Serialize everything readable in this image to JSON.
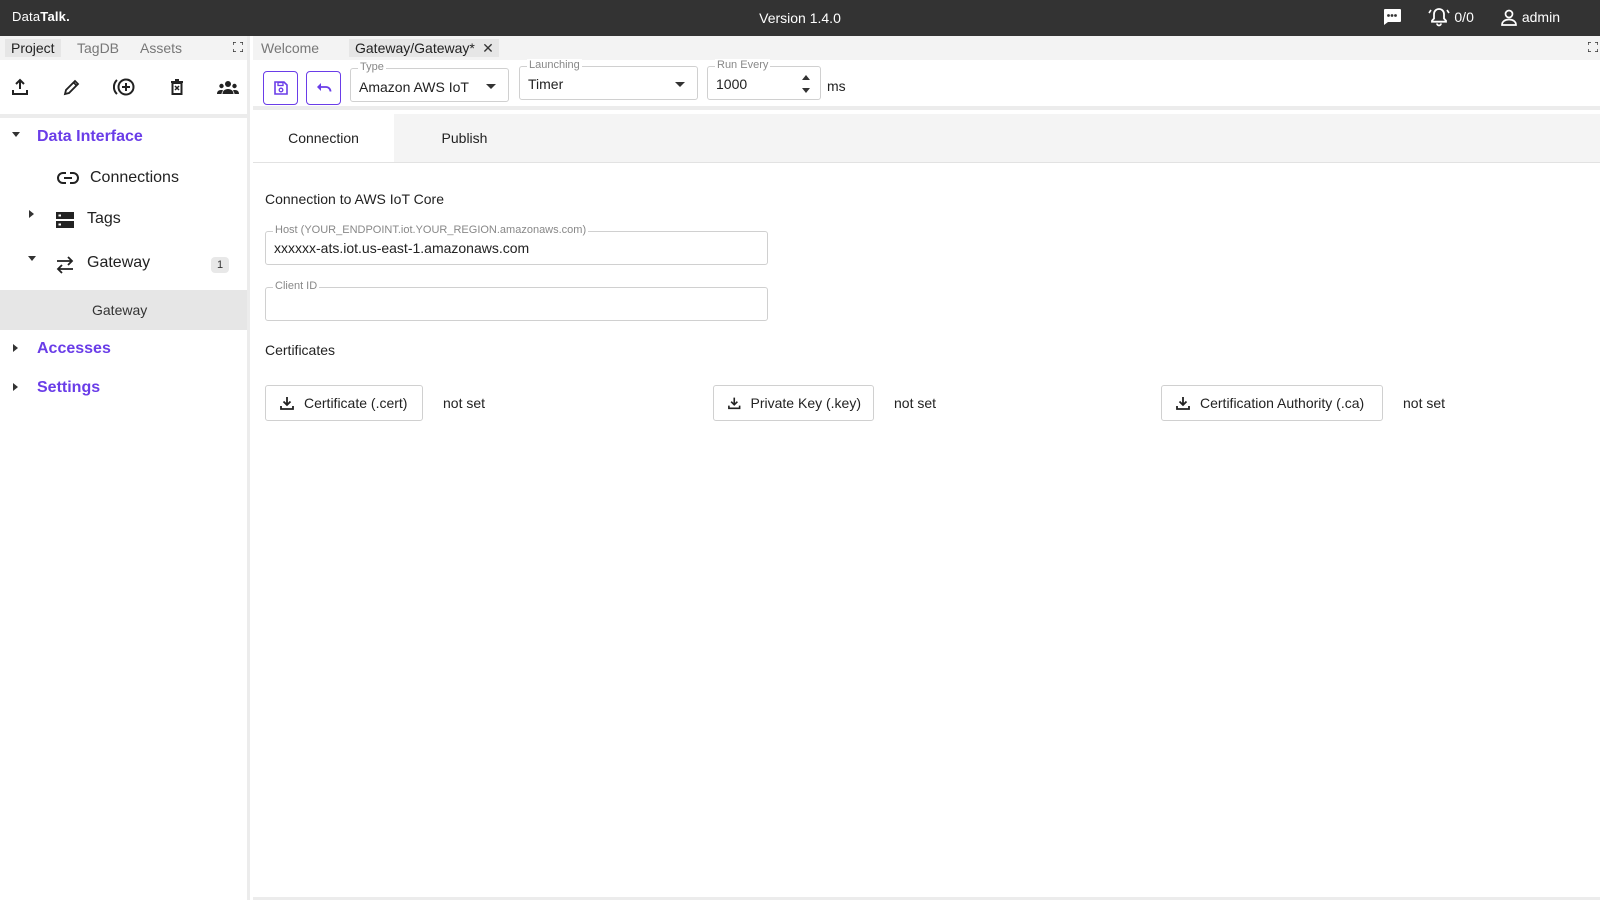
{
  "topbar": {
    "logo_prefix": "Data",
    "logo_bold": "Talk.",
    "version": "Version 1.4.0",
    "alarms": "0/0",
    "user": "admin",
    "icons": [
      "chat-icon",
      "bell-icon",
      "user-icon"
    ]
  },
  "left_panel": {
    "tabs": [
      "Project",
      "TagDB",
      "Assets"
    ],
    "active_tab": "Project",
    "toolbar_icons": [
      "upload-icon",
      "edit-icon",
      "add-circle-icon",
      "delete-icon",
      "groups-icon"
    ],
    "tree": {
      "data_interface": "Data Interface",
      "connections": "Connections",
      "tags": "Tags",
      "gateway": "Gateway",
      "gateway_count": "1",
      "gateway_child": "Gateway",
      "accesses": "Accesses",
      "settings": "Settings"
    }
  },
  "editor": {
    "tabs": {
      "welcome": "Welcome",
      "gateway": "Gateway/Gateway*",
      "close": "✕"
    },
    "toolbar": {
      "type_label": "Type",
      "type_value": "Amazon AWS IoT",
      "launching_label": "Launching",
      "launching_value": "Timer",
      "run_every_label": "Run Every",
      "run_every_value": "1000",
      "unit": "ms"
    },
    "content_tabs": [
      "Connection",
      "Publish"
    ],
    "active_content_tab": "Connection",
    "connection": {
      "title": "Connection to AWS IoT Core",
      "host_label": "Host (YOUR_ENDPOINT.iot.YOUR_REGION.amazonaws.com)",
      "host_value": "xxxxxx-ats.iot.us-east-1.amazonaws.com",
      "client_id_label": "Client ID",
      "client_id_value": "",
      "certificates_title": "Certificates",
      "certificate_button": "Certificate (.cert)",
      "certificate_status": "not set",
      "private_key_button": "Private Key (.key)",
      "private_key_status": "not set",
      "ca_button": "Certification Authority (.ca)",
      "ca_status": "not set"
    }
  },
  "colors": {
    "accent": "#6a3de8",
    "topbar": "#333333",
    "selected": "#e6e6e6"
  }
}
